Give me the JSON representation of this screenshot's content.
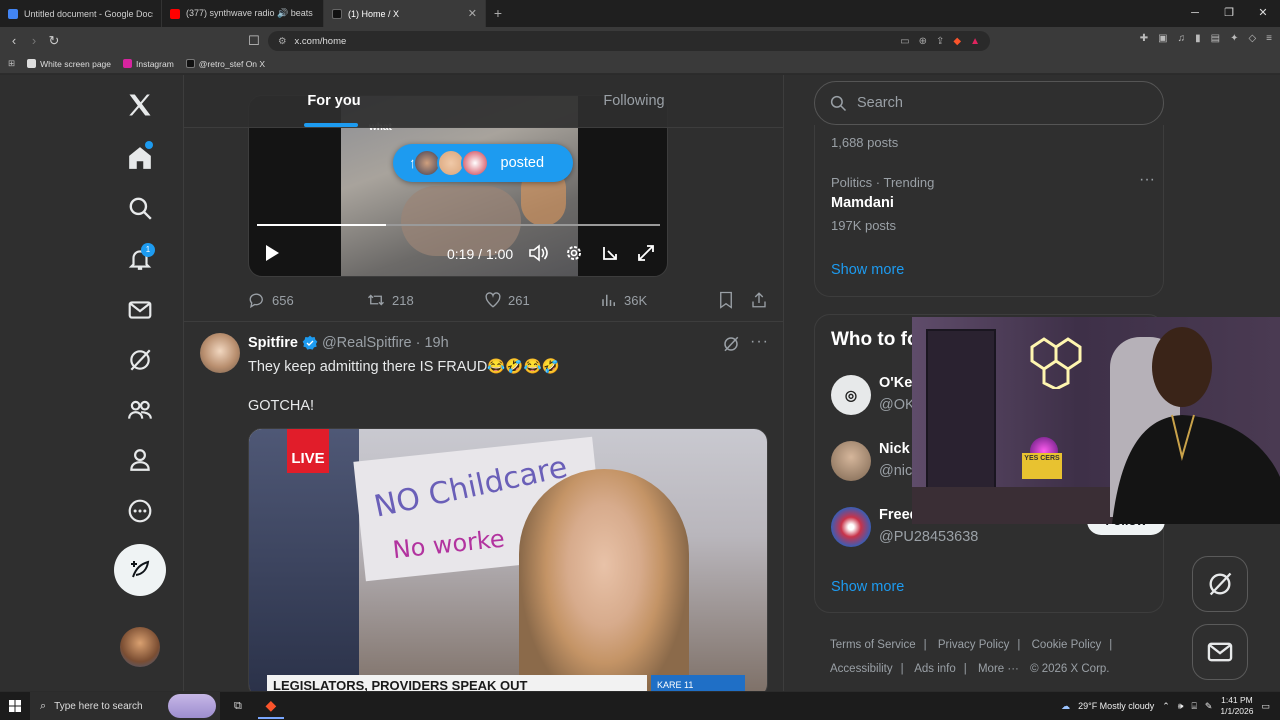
{
  "browser": {
    "tabs": [
      {
        "title": "Untitled document - Google Docs",
        "color": "#4285f4",
        "active": false
      },
      {
        "title": "(377) synthwave radio 🔊 beats t",
        "color": "#ff0000",
        "active": false
      },
      {
        "title": "(1) Home / X",
        "color": "#111111",
        "active": true
      }
    ],
    "url": "x.com/home",
    "bookmarks": [
      {
        "label": "White screen page",
        "color": "#dddddd"
      },
      {
        "label": "Instagram",
        "color": "#d6249f"
      },
      {
        "label": "@retro_stef On X",
        "color": "#111111"
      }
    ]
  },
  "nav": {
    "notification_count": "1"
  },
  "feed": {
    "tabs": [
      "For you",
      "Following"
    ],
    "active_tab": "For you",
    "new_posts_pill": {
      "label": "posted",
      "arrow": "↑"
    },
    "video": {
      "overlay_text": "what",
      "time": "0:19 / 1:00",
      "progress": 0.32
    },
    "post1_actions": {
      "replies": "656",
      "reposts": "218",
      "likes": "261",
      "views": "36K"
    },
    "post2": {
      "name": "Spitfire",
      "handle": "@RealSpitfire",
      "time": "· 19h",
      "text": "They keep admitting there IS FRAUD😂🤣😂🤣",
      "text2": "GOTCHA!",
      "live": "LIVE",
      "sign_line1": "NO Childcare",
      "sign_line2": "No worke",
      "lower_third": "LEGISLATORS, PROVIDERS SPEAK OUT",
      "station": "KARE 11"
    }
  },
  "sidebar": {
    "search_placeholder": "Search",
    "trends": [
      {
        "posts": "1,688 posts"
      },
      {
        "meta": "Politics · Trending",
        "title": "Mamdani",
        "posts": "197K posts"
      }
    ],
    "trends_show_more": "Show more",
    "who_title": "Who to follow",
    "who": [
      {
        "name": "O'Ke",
        "handle": "@OK",
        "color": "#e7e9ea"
      },
      {
        "name": "Nick",
        "handle": "@nic",
        "color": "#8a7460"
      },
      {
        "name": "Freed",
        "handle": "@PU28453638",
        "color": "#3b5db4"
      }
    ],
    "follow_label": "Follow",
    "who_show_more": "Show more",
    "footer": [
      "Terms of Service",
      "|",
      "Privacy Policy",
      "|",
      "Cookie Policy",
      "|",
      "Accessibility",
      "|",
      "Ads info",
      "|",
      "More ···",
      "© 2026 X Corp."
    ]
  },
  "webcam": {
    "sign_text": "YES CERS"
  },
  "taskbar": {
    "search_placeholder": "Type here to search",
    "weather": "29°F  Mostly cloudy",
    "time": "1:41 PM",
    "date": "1/1/2026"
  },
  "colors": {
    "accent": "#1d9bf0",
    "background": "#2f2f2f"
  }
}
